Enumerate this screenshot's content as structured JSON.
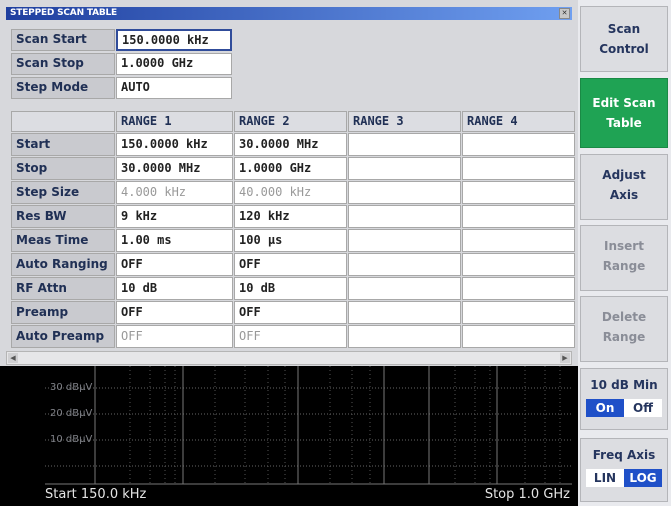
{
  "title": "STEPPED SCAN TABLE",
  "scan": {
    "start_label": "Scan Start",
    "start_value": "150.0000 kHz",
    "stop_label": "Scan Stop",
    "stop_value": "1.0000 GHz",
    "mode_label": "Step Mode",
    "mode_value": "AUTO"
  },
  "table": {
    "headers": [
      "RANGE 1",
      "RANGE 2",
      "RANGE 3",
      "RANGE 4"
    ],
    "rows": [
      {
        "label": "Start",
        "values": [
          "150.0000 kHz",
          "30.0000 MHz",
          "",
          ""
        ]
      },
      {
        "label": "Stop",
        "values": [
          "30.0000 MHz",
          "1.0000 GHz",
          "",
          ""
        ]
      },
      {
        "label": "Step Size",
        "values": [
          "4.000 kHz",
          "40.000 kHz",
          "",
          ""
        ]
      },
      {
        "label": "Res BW",
        "values": [
          "9 kHz",
          "120 kHz",
          "",
          ""
        ]
      },
      {
        "label": "Meas Time",
        "values": [
          "1.00 ms",
          "100 µs",
          "",
          ""
        ]
      },
      {
        "label": "Auto Ranging",
        "values": [
          "OFF",
          "OFF",
          "",
          ""
        ]
      },
      {
        "label": "RF Attn",
        "values": [
          "10 dB",
          "10 dB",
          "",
          ""
        ]
      },
      {
        "label": "Preamp",
        "values": [
          "OFF",
          "OFF",
          "",
          ""
        ]
      },
      {
        "label": "Auto Preamp",
        "values": [
          "OFF",
          "OFF",
          "",
          ""
        ]
      }
    ]
  },
  "plot": {
    "ylabels": [
      "30 dBµV",
      "20 dBµV",
      "10 dBµV"
    ],
    "start": "Start 150.0 kHz",
    "stop": "Stop 1.0 GHz"
  },
  "softkeys": {
    "scan_control": [
      "Scan",
      "Control"
    ],
    "edit_scan_table": [
      "Edit Scan",
      "Table"
    ],
    "adjust_axis": [
      "Adjust",
      "Axis"
    ],
    "insert_range": [
      "Insert",
      "Range"
    ],
    "delete_range": [
      "Delete",
      "Range"
    ],
    "min_10db": {
      "label": "10 dB Min",
      "on": "On",
      "off": "Off",
      "state": "On"
    },
    "freq_axis": {
      "label": "Freq Axis",
      "lin": "LIN",
      "log": "LOG",
      "state": "LOG"
    }
  },
  "colors": {
    "active_softkey": "#1fa354",
    "toggle_on": "#1f50c8",
    "title_bar": "#1f3f9f"
  }
}
